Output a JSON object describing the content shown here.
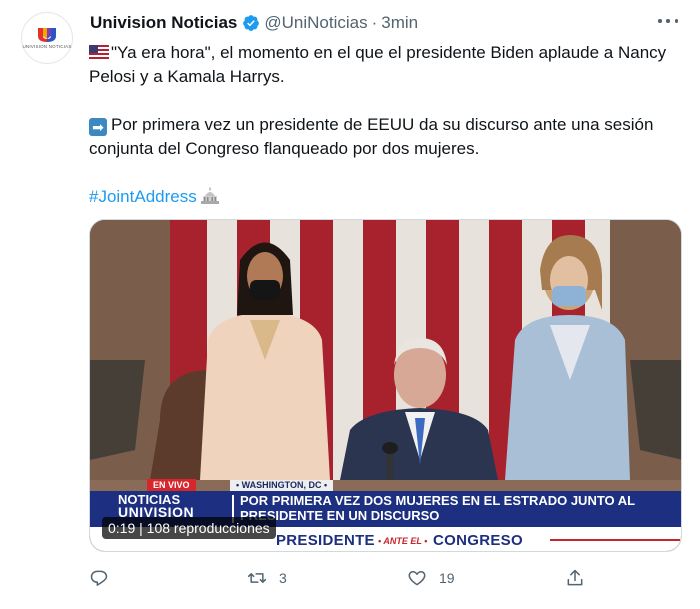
{
  "account": {
    "display_name": "Univision Noticias",
    "handle": "@UniNoticias",
    "separator": "·",
    "time": "3min",
    "avatar_label": "UNIVISION NOTICIAS"
  },
  "tweet": {
    "line1": "\"Ya era hora\", el momento en el que el presidente Biden aplaude a Nancy Pelosi y a Kamala Harrys.",
    "line2": "Por primera vez un presidente de EEUU da su discurso ante una sesión conjunta del Congreso flanqueado por dos mujeres.",
    "hashtag": "#JointAddress"
  },
  "media": {
    "live_badge": "EN VIVO",
    "location": "• WASHINGTON, DC •",
    "brand_line1": "NOTICIAS",
    "brand_line2": "UNIVISION",
    "headline": "POR PRIMERA VEZ DOS MUJERES EN EL ESTRADO JUNTO AL PRESIDENTE EN UN DISCURSO",
    "ribbon_left": "PRESIDENTE",
    "ribbon_middle": "• ANTE EL •",
    "ribbon_right": "CONGRESO",
    "timecode": "0:19 | 108 reproducciones"
  },
  "actions": {
    "retweets": "3",
    "likes": "19"
  },
  "colors": {
    "accent": "#1d9bf0",
    "muted": "#536471",
    "band": "#1c2f80",
    "live": "#d9262b"
  }
}
